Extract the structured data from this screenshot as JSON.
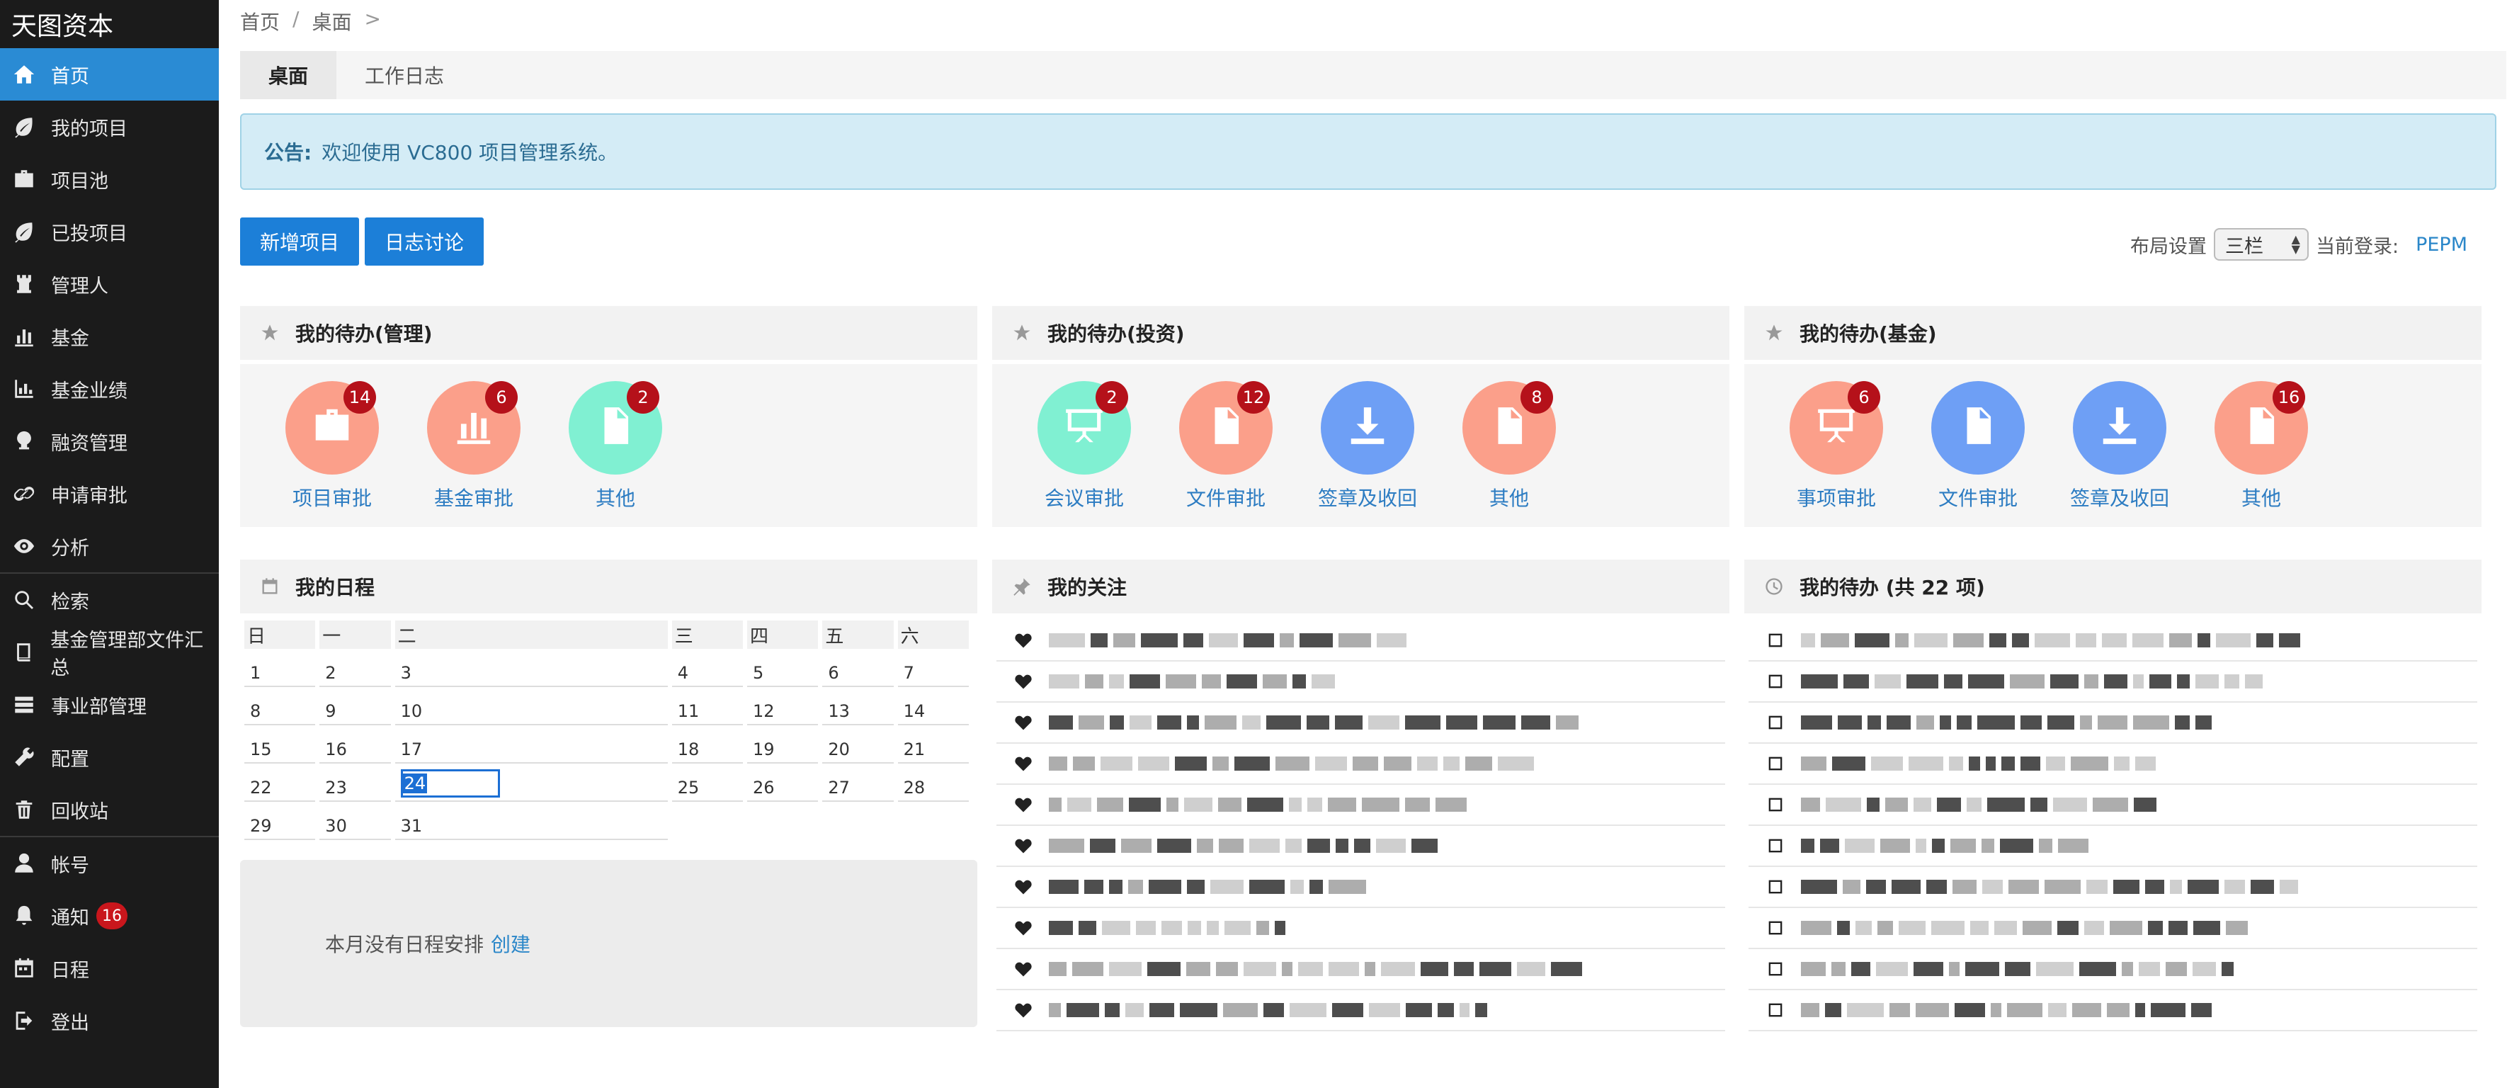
{
  "sidebar": {
    "brand": "天图资本",
    "items": [
      {
        "label": "首页",
        "icon": "home-icon",
        "active": true
      },
      {
        "label": "我的项目",
        "icon": "leaf-icon"
      },
      {
        "label": "项目池",
        "icon": "briefcase-icon"
      },
      {
        "label": "已投项目",
        "icon": "leaf-icon"
      },
      {
        "label": "管理人",
        "icon": "tower-icon"
      },
      {
        "label": "基金",
        "icon": "bar-chart-icon"
      },
      {
        "label": "基金业绩",
        "icon": "performance-chart-icon"
      },
      {
        "label": "融资管理",
        "icon": "tree-icon"
      },
      {
        "label": "申请审批",
        "icon": "link-icon"
      },
      {
        "label": "分析",
        "icon": "eye-icon"
      },
      {
        "label": "检索",
        "icon": "search-icon"
      },
      {
        "label": "基金管理部文件汇总",
        "icon": "book-icon"
      },
      {
        "label": "事业部管理",
        "icon": "server-icon"
      },
      {
        "label": "配置",
        "icon": "wrench-icon"
      },
      {
        "label": "回收站",
        "icon": "trash-icon"
      },
      {
        "label": "帐号",
        "icon": "user-icon"
      },
      {
        "label": "通知",
        "icon": "bell-icon",
        "badge": "16"
      },
      {
        "label": "日程",
        "icon": "calendar-icon"
      },
      {
        "label": "登出",
        "icon": "logout-icon"
      }
    ]
  },
  "breadcrumb": {
    "home": "首页",
    "sep": "/",
    "current": "桌面",
    "arrow": ">"
  },
  "tabs": [
    {
      "label": "桌面"
    },
    {
      "label": "工作日志"
    }
  ],
  "notice": {
    "label": "公告:",
    "text": "欢迎使用 VC800 项目管理系统。"
  },
  "buttons": {
    "new_project": "新增项目",
    "log_discussion": "日志讨论"
  },
  "layout": {
    "label": "布局设置",
    "value": "三栏",
    "login_label": "当前登录:",
    "user": "PEPM"
  },
  "panels": {
    "manage": {
      "title": "我的待办(管理)",
      "items": [
        {
          "label": "项目审批",
          "count": "14",
          "color": "#fb9f8a",
          "icon": "briefcase-icon"
        },
        {
          "label": "基金审批",
          "count": "6",
          "color": "#fb9f8a",
          "icon": "bar-chart-icon"
        },
        {
          "label": "其他",
          "count": "2",
          "color": "#80f0d2",
          "icon": "file-icon"
        }
      ]
    },
    "invest": {
      "title": "我的待办(投资)",
      "items": [
        {
          "label": "会议审批",
          "count": "2",
          "color": "#80f0d2",
          "icon": "presentation-icon"
        },
        {
          "label": "文件审批",
          "count": "12",
          "color": "#fb9f8a",
          "icon": "file-icon"
        },
        {
          "label": "签章及收回",
          "count": "",
          "color": "#6e9ff5",
          "icon": "download-icon"
        },
        {
          "label": "其他",
          "count": "8",
          "color": "#fb9f8a",
          "icon": "file-icon"
        }
      ]
    },
    "fund": {
      "title": "我的待办(基金)",
      "items": [
        {
          "label": "事项审批",
          "count": "6",
          "color": "#fb9f8a",
          "icon": "presentation-icon"
        },
        {
          "label": "文件审批",
          "count": "",
          "color": "#6e9ff5",
          "icon": "file-icon"
        },
        {
          "label": "签章及收回",
          "count": "",
          "color": "#6e9ff5",
          "icon": "download-icon"
        },
        {
          "label": "其他",
          "count": "16",
          "color": "#fb9f8a",
          "icon": "file-icon"
        }
      ]
    },
    "schedule": {
      "title": "我的日程",
      "weekdays": [
        "日",
        "一",
        "二",
        "三",
        "四",
        "五",
        "六"
      ],
      "weeks": [
        [
          "1",
          "2",
          "3",
          "4",
          "5",
          "6",
          "7"
        ],
        [
          "8",
          "9",
          "10",
          "11",
          "12",
          "13",
          "14"
        ],
        [
          "15",
          "16",
          "17",
          "18",
          "19",
          "20",
          "21"
        ],
        [
          "22",
          "23",
          "24",
          "25",
          "26",
          "27",
          "28"
        ],
        [
          "29",
          "30",
          "31",
          "",
          "",
          "",
          ""
        ]
      ],
      "today": "24",
      "empty_text": "本月没有日程安排",
      "create_label": "创建"
    },
    "follow": {
      "title": "我的关注",
      "rows": 10
    },
    "todo_all": {
      "title": "我的待办 (共 22 项)",
      "rows": 10
    }
  }
}
